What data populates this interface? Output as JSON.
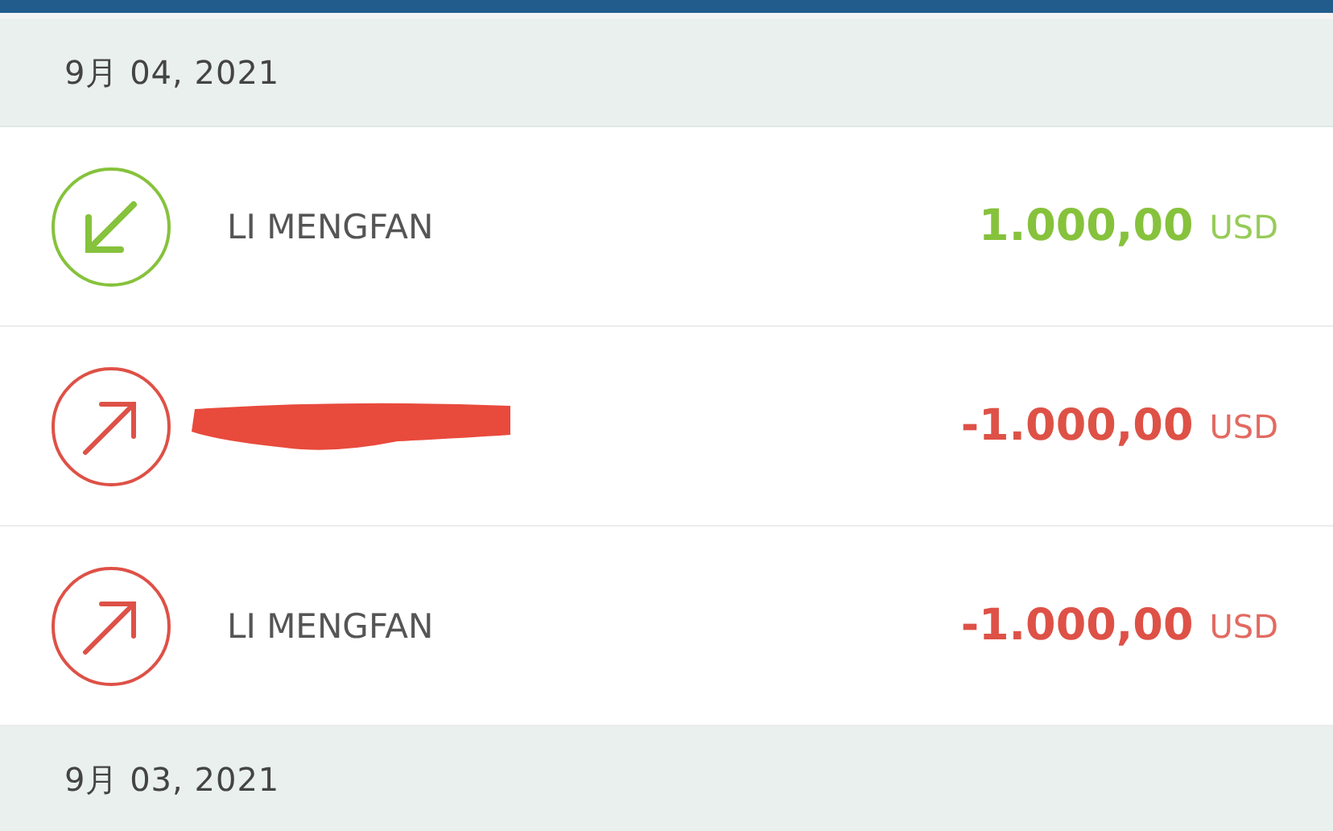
{
  "groups": [
    {
      "date": "9月 04, 2021",
      "transactions": [
        {
          "kind": "incoming",
          "name": "LI MENGFAN",
          "redacted": false,
          "amount": "1.000,00",
          "currency": "USD"
        },
        {
          "kind": "outgoing",
          "redacted": true,
          "amount": "-1.000,00",
          "currency": "USD"
        },
        {
          "kind": "outgoing",
          "name": "LI MENGFAN",
          "redacted": false,
          "amount": "-1.000,00",
          "currency": "USD"
        }
      ]
    },
    {
      "date": "9月 03, 2021"
    }
  ]
}
